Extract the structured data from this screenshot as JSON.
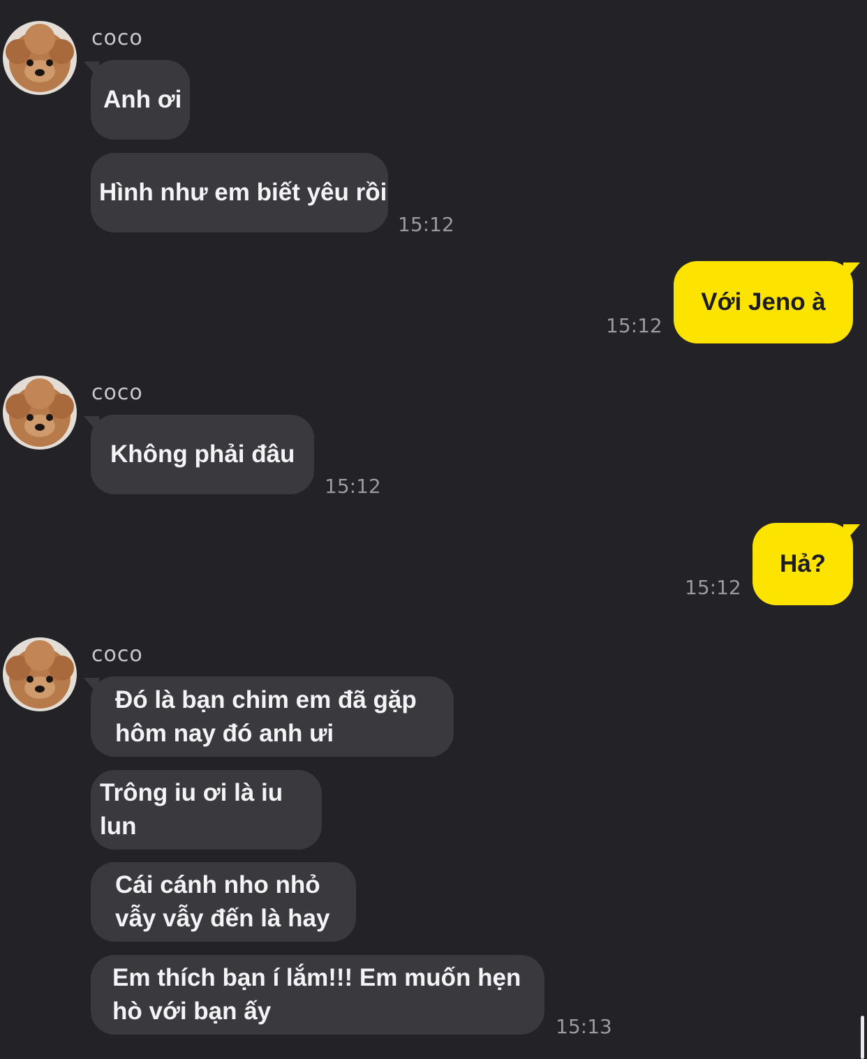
{
  "contact": {
    "name": "coco",
    "avatar_icon": "poodle-avatar-icon"
  },
  "groups": [
    {
      "sender": "coco",
      "messages": [
        "Anh ơi",
        "Hình như em biết yêu rồi"
      ],
      "time": "15:12"
    },
    {
      "outgoing": true,
      "messages": [
        "Với Jeno à"
      ],
      "time": "15:12"
    },
    {
      "sender": "coco",
      "messages": [
        "Không phải đâu"
      ],
      "time": "15:12"
    },
    {
      "outgoing": true,
      "messages": [
        "Hả?"
      ],
      "time": "15:12"
    },
    {
      "sender": "coco",
      "messages": [
        "Đó là bạn chim em đã gặp\nhôm nay đó anh ưi",
        "Trông iu ơi là iu lun",
        "Cái cánh nho nhỏ\nvẫy vẫy đến là hay",
        "Em thích bạn í lắm!!! Em muốn hẹn\nhò với bạn ấy"
      ],
      "time": "15:13"
    }
  ],
  "colors": {
    "background": "#232227",
    "incoming_bubble": "#3a393e",
    "outgoing_bubble": "#fde400"
  }
}
